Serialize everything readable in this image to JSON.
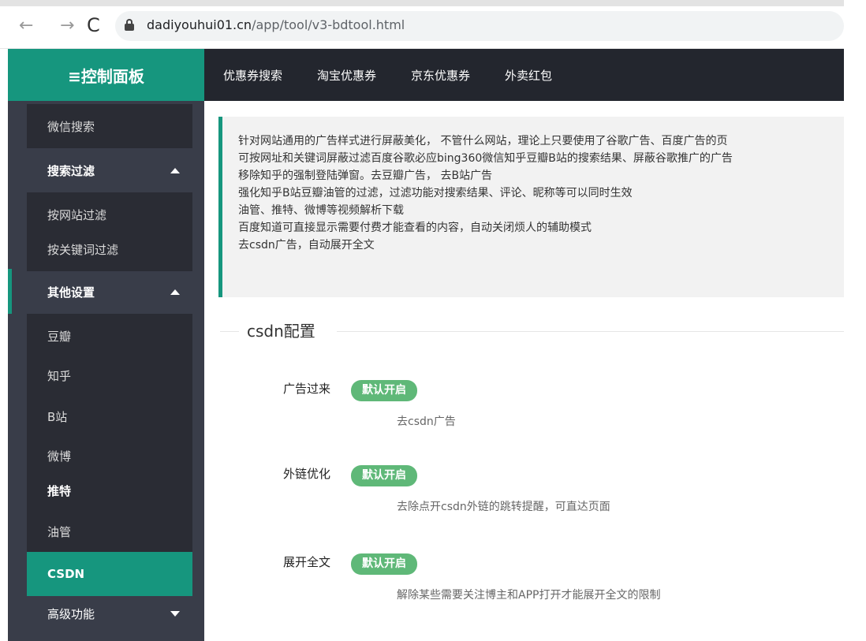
{
  "browser": {
    "url_host": "dadiyouhui01.cn",
    "url_path": "/app/tool/v3-bdtool.html",
    "back_glyph": "←",
    "forward_glyph": "→",
    "reload_glyph": "C"
  },
  "header": {
    "title": "≡控制面板",
    "nav": [
      "优惠券搜索",
      "淘宝优惠券",
      "京东优惠券",
      "外卖红包"
    ]
  },
  "sidebar": {
    "items": [
      {
        "label": "微信搜索"
      },
      {
        "label": "搜索过滤"
      },
      {
        "label": "按网站过滤"
      },
      {
        "label": "按关键词过滤"
      },
      {
        "label": "其他设置"
      },
      {
        "label": "豆瓣"
      },
      {
        "label": "知乎"
      },
      {
        "label": "B站"
      },
      {
        "label": "微博"
      },
      {
        "label": "推特"
      },
      {
        "label": "油管"
      },
      {
        "label": "CSDN"
      },
      {
        "label": "高级功能"
      }
    ]
  },
  "main": {
    "intro_lines": [
      "针对网站通用的广告样式进行屏蔽美化， 不管什么网站，理论上只要使用了谷歌广告、百度广告的页",
      "可按网址和关键词屏蔽过滤百度谷歌必应bing360微信知乎豆瓣B站的搜索结果、屏蔽谷歌推广的广告",
      "移除知乎的强制登陆弹窗。去豆瓣广告， 去B站广告",
      "强化知乎B站豆瓣油管的过滤，过滤功能对搜索结果、评论、昵称等可以同时生效",
      "油管、推特、微博等视频解析下载",
      "百度知道可直接显示需要付费才能查看的内容，自动关闭烦人的辅助模式",
      "去csdn广告，自动展开全文"
    ],
    "section_title": "csdn配置",
    "settings": [
      {
        "label": "广告过来",
        "badge": "默认开启",
        "desc": "去csdn广告"
      },
      {
        "label": "外链优化",
        "badge": "默认开启",
        "desc": "去除点开csdn外链的跳转提醒，可直达页面"
      },
      {
        "label": "展开全文",
        "badge": "默认开启",
        "desc": "解除某些需要关注博主和APP打开才能展开全文的限制"
      }
    ]
  },
  "colors": {
    "accent": "#16967e",
    "sidebar_bg": "#393d49",
    "topnav_bg": "#23262e",
    "badge_bg": "#5fb878"
  }
}
